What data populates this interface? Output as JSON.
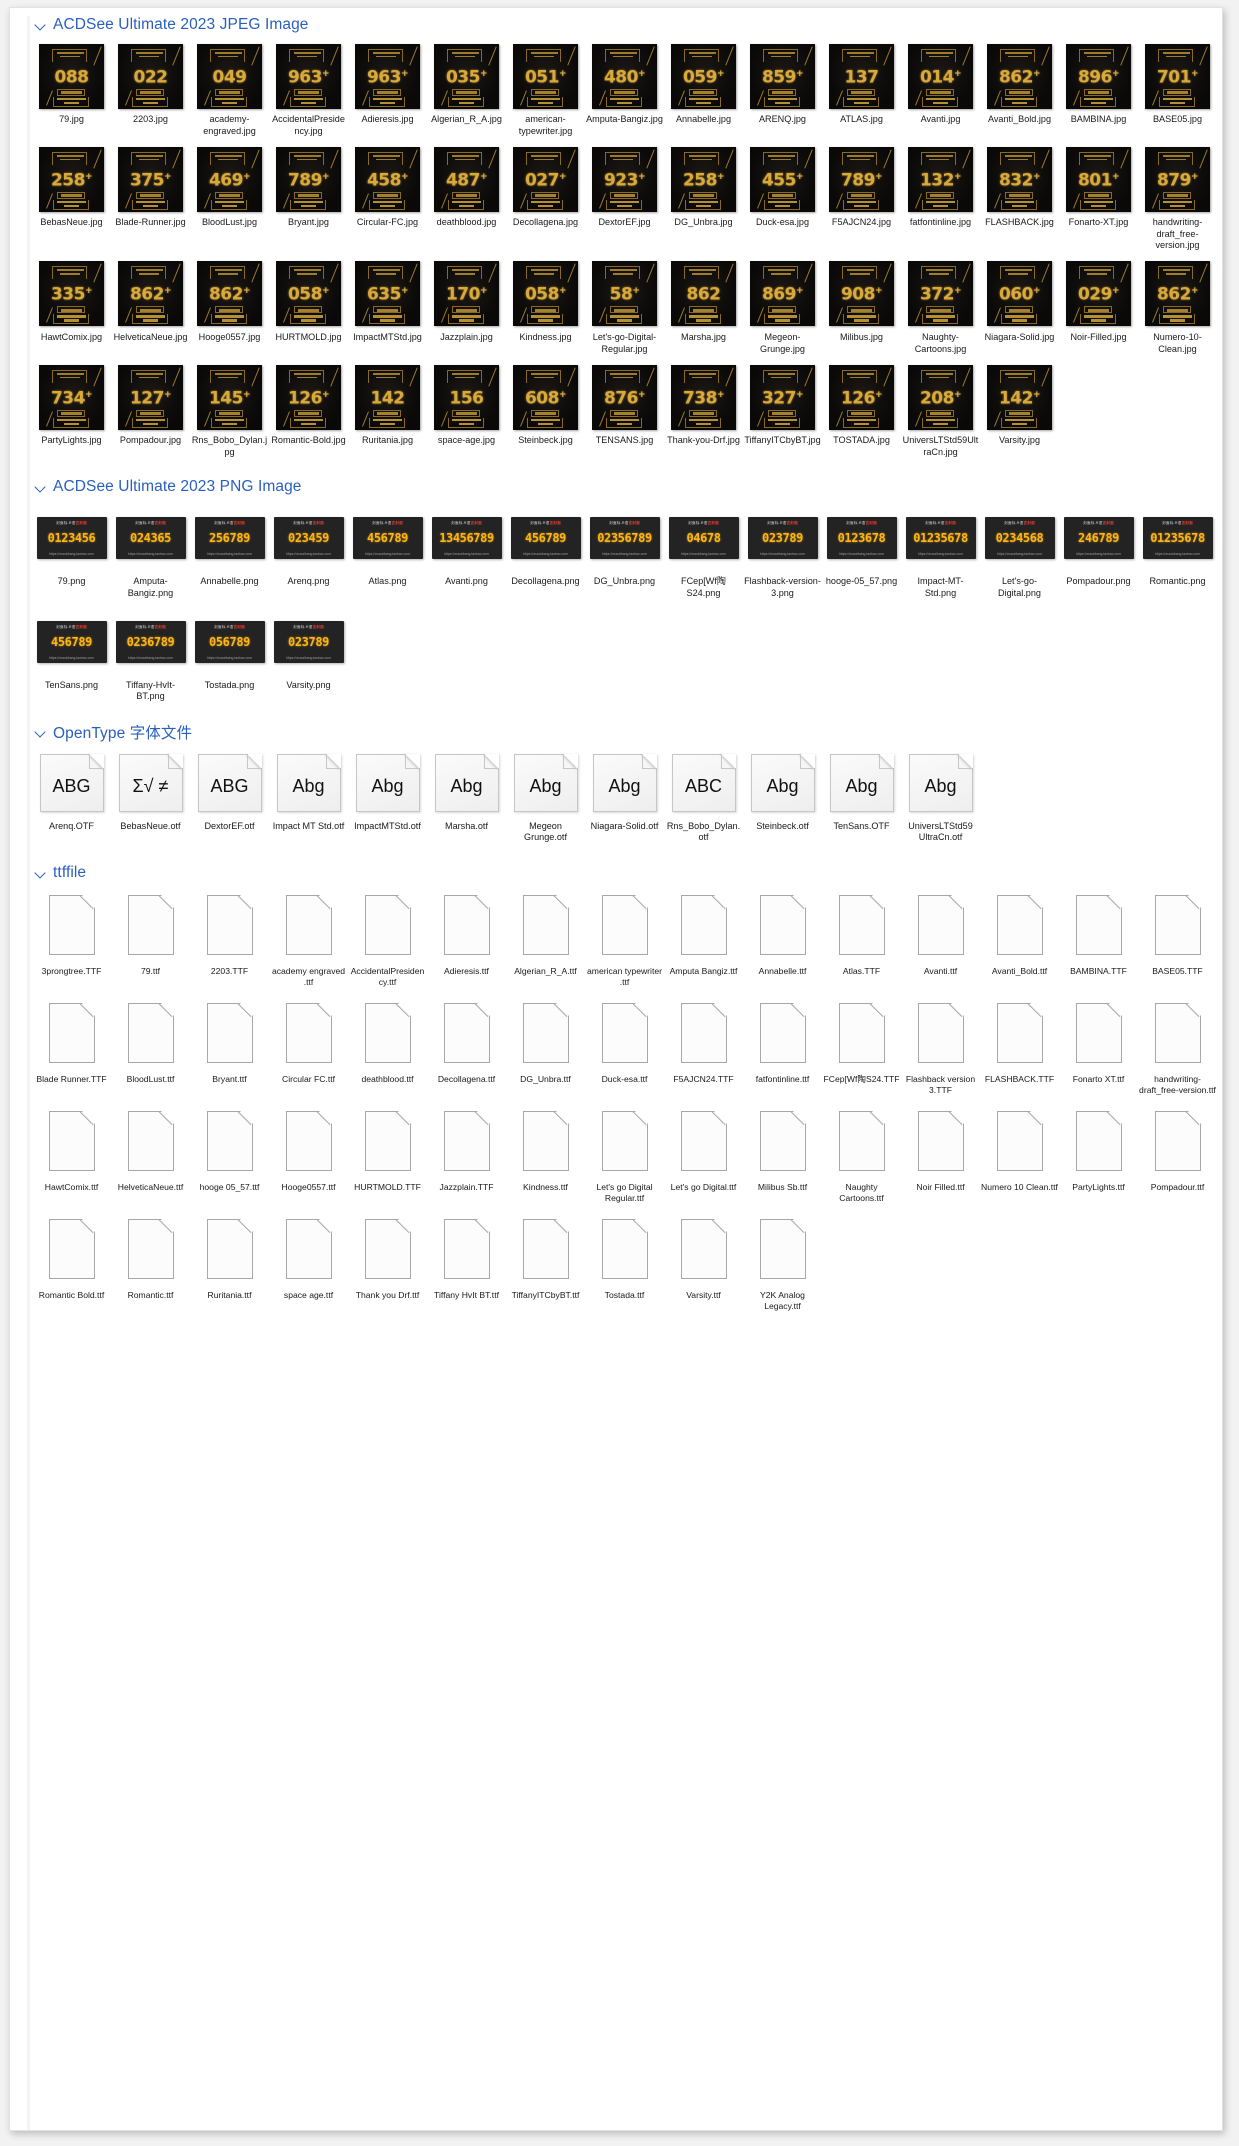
{
  "window": {
    "title": ""
  },
  "groups": [
    {
      "id": "jpeg",
      "label": "ACDSee Ultimate 2023 JPEG Image",
      "icon": "chevron-down-icon",
      "kind": "poster",
      "items": [
        {
          "name": "79.jpg",
          "num": "088",
          "sup": ""
        },
        {
          "name": "2203.jpg",
          "num": "022",
          "sup": ""
        },
        {
          "name": "academy-engraved.jpg",
          "num": "049",
          "sup": ""
        },
        {
          "name": "AccidentalPresidency.jpg",
          "num": "963",
          "sup": "+"
        },
        {
          "name": "Adieresis.jpg",
          "num": "963",
          "sup": "+"
        },
        {
          "name": "Algerian_R_A.jpg",
          "num": "035",
          "sup": "+"
        },
        {
          "name": "american-typewriter.jpg",
          "num": "051",
          "sup": "+"
        },
        {
          "name": "Amputa-Bangiz.jpg",
          "num": "480",
          "sup": "+"
        },
        {
          "name": "Annabelle.jpg",
          "num": "059",
          "sup": "+"
        },
        {
          "name": "ARENQ.jpg",
          "num": "859",
          "sup": "+"
        },
        {
          "name": "ATLAS.jpg",
          "num": "137",
          "sup": ""
        },
        {
          "name": "Avanti.jpg",
          "num": "014",
          "sup": "+"
        },
        {
          "name": "Avanti_Bold.jpg",
          "num": "862",
          "sup": "+"
        },
        {
          "name": "BAMBINA.jpg",
          "num": "896",
          "sup": "+"
        },
        {
          "name": "BASE05.jpg",
          "num": "701",
          "sup": "+"
        },
        {
          "name": "BebasNeue.jpg",
          "num": "258",
          "sup": "+"
        },
        {
          "name": "Blade-Runner.jpg",
          "num": "375",
          "sup": "+"
        },
        {
          "name": "BloodLust.jpg",
          "num": "469",
          "sup": "+"
        },
        {
          "name": "Bryant.jpg",
          "num": "789",
          "sup": "+"
        },
        {
          "name": "Circular-FC.jpg",
          "num": "458",
          "sup": "+"
        },
        {
          "name": "deathblood.jpg",
          "num": "487",
          "sup": "+"
        },
        {
          "name": "Decollagena.jpg",
          "num": "027",
          "sup": "+"
        },
        {
          "name": "DextorEF.jpg",
          "num": "923",
          "sup": "+"
        },
        {
          "name": "DG_Unbra.jpg",
          "num": "258",
          "sup": "+"
        },
        {
          "name": "Duck-esa.jpg",
          "num": "455",
          "sup": "+"
        },
        {
          "name": "F5AJCN24.jpg",
          "num": "789",
          "sup": "+"
        },
        {
          "name": "fatfontinline.jpg",
          "num": "132",
          "sup": "+"
        },
        {
          "name": "FLASHBACK.jpg",
          "num": "832",
          "sup": "+"
        },
        {
          "name": "Fonarto-XT.jpg",
          "num": "801",
          "sup": "+"
        },
        {
          "name": "handwriting-draft_free-version.jpg",
          "num": "879",
          "sup": "+"
        },
        {
          "name": "HawtComix.jpg",
          "num": "335",
          "sup": "+"
        },
        {
          "name": "HelveticaNeue.jpg",
          "num": "862",
          "sup": "+"
        },
        {
          "name": "Hooge0557.jpg",
          "num": "862",
          "sup": "+"
        },
        {
          "name": "HURTMOLD.jpg",
          "num": "058",
          "sup": "+"
        },
        {
          "name": "ImpactMTStd.jpg",
          "num": "635",
          "sup": "+"
        },
        {
          "name": "Jazzplain.jpg",
          "num": "170",
          "sup": "+"
        },
        {
          "name": "Kindness.jpg",
          "num": "058",
          "sup": "+"
        },
        {
          "name": "Let's-go-Digital-Regular.jpg",
          "num": "58",
          "sup": "+"
        },
        {
          "name": "Marsha.jpg",
          "num": "862",
          "sup": ""
        },
        {
          "name": "Megeon-Grunge.jpg",
          "num": "869",
          "sup": "+"
        },
        {
          "name": "Milibus.jpg",
          "num": "908",
          "sup": "+"
        },
        {
          "name": "Naughty-Cartoons.jpg",
          "num": "372",
          "sup": "+"
        },
        {
          "name": "Niagara-Solid.jpg",
          "num": "060",
          "sup": "+"
        },
        {
          "name": "Noir-Filled.jpg",
          "num": "029",
          "sup": "+"
        },
        {
          "name": "Numero-10-Clean.jpg",
          "num": "862",
          "sup": "+"
        },
        {
          "name": "PartyLights.jpg",
          "num": "734",
          "sup": "+"
        },
        {
          "name": "Pompadour.jpg",
          "num": "127",
          "sup": "+"
        },
        {
          "name": "Rns_Bobo_Dylan.jpg",
          "num": "145",
          "sup": "+"
        },
        {
          "name": "Romantic-Bold.jpg",
          "num": "126",
          "sup": "+"
        },
        {
          "name": "Ruritania.jpg",
          "num": "142",
          "sup": ""
        },
        {
          "name": "space-age.jpg",
          "num": "156",
          "sup": ""
        },
        {
          "name": "Steinbeck.jpg",
          "num": "608",
          "sup": "+"
        },
        {
          "name": "TENSANS.jpg",
          "num": "876",
          "sup": "+"
        },
        {
          "name": "Thank-you-Drf.jpg",
          "num": "738",
          "sup": "+"
        },
        {
          "name": "TiffanyITCbyBT.jpg",
          "num": "327",
          "sup": "+"
        },
        {
          "name": "TOSTADA.jpg",
          "num": "126",
          "sup": "+"
        },
        {
          "name": "UniversLTStd59UltraCn.jpg",
          "num": "208",
          "sup": "+"
        },
        {
          "name": "Varsity.jpg",
          "num": "142",
          "sup": "+"
        }
      ]
    },
    {
      "id": "png",
      "label": "ACDSee Ultimate 2023 PNG Image",
      "icon": "chevron-down-icon",
      "kind": "png",
      "header_text": "封面标-R语",
      "header_red": "言封面",
      "url_text": "https://wucaibang.taobao.com",
      "items": [
        {
          "name": "79.png",
          "digits": "0123456"
        },
        {
          "name": "Amputa-Bangiz.png",
          "digits": "024365"
        },
        {
          "name": "Annabelle.png",
          "digits": "256789"
        },
        {
          "name": "Arenq.png",
          "digits": "023459"
        },
        {
          "name": "Atlas.png",
          "digits": "456789"
        },
        {
          "name": "Avanti.png",
          "digits": "13456789"
        },
        {
          "name": "Decollagena.png",
          "digits": "456789"
        },
        {
          "name": "DG_Unbra.png",
          "digits": "02356789"
        },
        {
          "name": "FCep[Wf陶S24.png",
          "digits": "04678"
        },
        {
          "name": "Flashback-version-3.png",
          "digits": "023789"
        },
        {
          "name": "hooge-05_57.png",
          "digits": "0123678"
        },
        {
          "name": "Impact-MT-Std.png",
          "digits": "01235678"
        },
        {
          "name": "Let's-go-Digital.png",
          "digits": "0234568"
        },
        {
          "name": "Pompadour.png",
          "digits": "246789"
        },
        {
          "name": "Romantic.png",
          "digits": "01235678"
        },
        {
          "name": "TenSans.png",
          "digits": "456789"
        },
        {
          "name": "Tiffany-HvIt-BT.png",
          "digits": "0236789"
        },
        {
          "name": "Tostada.png",
          "digits": "056789"
        },
        {
          "name": "Varsity.png",
          "digits": "023789"
        }
      ]
    },
    {
      "id": "otf",
      "label": "OpenType 字体文件",
      "icon": "chevron-down-icon",
      "kind": "otf",
      "items": [
        {
          "name": "Arenq.OTF",
          "sample": "ABG"
        },
        {
          "name": "BebasNeue.otf",
          "sample": "Σ√ ≠"
        },
        {
          "name": "DextorEF.otf",
          "sample": "ABG"
        },
        {
          "name": "Impact MT Std.otf",
          "sample": "Abg"
        },
        {
          "name": "ImpactMTStd.otf",
          "sample": "Abg"
        },
        {
          "name": "Marsha.otf",
          "sample": "Abg"
        },
        {
          "name": "Megeon Grunge.otf",
          "sample": "Abg"
        },
        {
          "name": "Niagara-Solid.otf",
          "sample": "Abg"
        },
        {
          "name": "Rns_Bobo_Dylan.otf",
          "sample": "ABC"
        },
        {
          "name": "Steinbeck.otf",
          "sample": "Abg"
        },
        {
          "name": "TenSans.OTF",
          "sample": "Abg"
        },
        {
          "name": "UniversLTStd59 UltraCn.otf",
          "sample": "Abg"
        }
      ]
    },
    {
      "id": "ttf",
      "label": "ttffile",
      "icon": "chevron-down-icon",
      "kind": "ttf",
      "items": [
        {
          "name": "3prongtree.TTF"
        },
        {
          "name": "79.ttf"
        },
        {
          "name": "2203.TTF"
        },
        {
          "name": "academy engraved .ttf"
        },
        {
          "name": "AccidentalPresidency.ttf"
        },
        {
          "name": "Adieresis.ttf"
        },
        {
          "name": "Algerian_R_A.ttf"
        },
        {
          "name": "american typewriter .ttf"
        },
        {
          "name": "Amputa Bangiz.ttf"
        },
        {
          "name": "Annabelle.ttf"
        },
        {
          "name": "Atlas.TTF"
        },
        {
          "name": "Avanti.ttf"
        },
        {
          "name": "Avanti_Bold.ttf"
        },
        {
          "name": "BAMBINA.TTF"
        },
        {
          "name": "BASE05.TTF"
        },
        {
          "name": "Blade Runner.TTF"
        },
        {
          "name": "BloodLust.ttf"
        },
        {
          "name": "Bryant.ttf"
        },
        {
          "name": "Circular FC.ttf"
        },
        {
          "name": "deathblood.ttf"
        },
        {
          "name": "Decollagena.ttf"
        },
        {
          "name": "DG_Unbra.ttf"
        },
        {
          "name": "Duck-esa.ttf"
        },
        {
          "name": "F5AJCN24.TTF"
        },
        {
          "name": "fatfontinline.ttf"
        },
        {
          "name": "FCep[Wf陶S24.TTF"
        },
        {
          "name": "Flashback version 3.TTF"
        },
        {
          "name": "FLASHBACK.TTF"
        },
        {
          "name": "Fonarto XT.ttf"
        },
        {
          "name": "handwriting-draft_free-version.ttf"
        },
        {
          "name": "HawtComix.ttf"
        },
        {
          "name": "HelveticaNeue.ttf"
        },
        {
          "name": "hooge 05_57.ttf"
        },
        {
          "name": "Hooge0557.ttf"
        },
        {
          "name": "HURTMOLD.TTF"
        },
        {
          "name": "Jazzplain.TTF"
        },
        {
          "name": "Kindness.ttf"
        },
        {
          "name": "Let's go Digital Regular.ttf"
        },
        {
          "name": "Let's go Digital.ttf"
        },
        {
          "name": "Milibus Sb.ttf"
        },
        {
          "name": "Naughty Cartoons.ttf"
        },
        {
          "name": "Noir Filled.ttf"
        },
        {
          "name": "Numero 10 Clean.ttf"
        },
        {
          "name": "PartyLights.ttf"
        },
        {
          "name": "Pompadour.ttf"
        },
        {
          "name": "Romantic Bold.ttf"
        },
        {
          "name": "Romantic.ttf"
        },
        {
          "name": "Ruritania.ttf"
        },
        {
          "name": "space age.ttf"
        },
        {
          "name": "Thank you Drf.ttf"
        },
        {
          "name": "Tiffany HvIt BT.ttf"
        },
        {
          "name": "TiffanyITCbyBT.ttf"
        },
        {
          "name": "Tostada.ttf"
        },
        {
          "name": "Varsity.ttf"
        },
        {
          "name": "Y2K Analog Legacy.ttf"
        }
      ]
    }
  ]
}
